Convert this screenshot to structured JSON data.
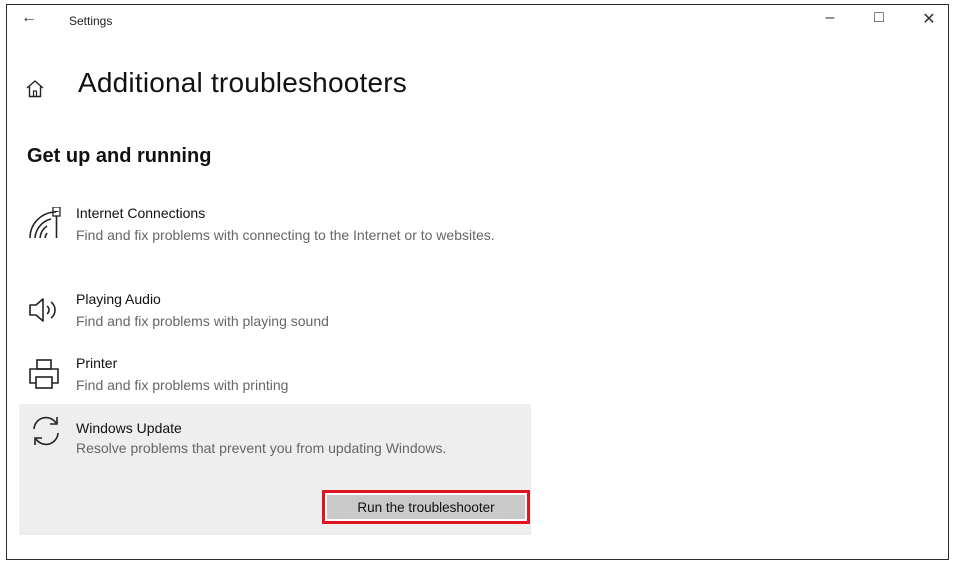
{
  "window": {
    "title": "Settings",
    "back_icon": "←",
    "minimize_icon": "–",
    "maximize_icon": "□",
    "close_icon": "✕"
  },
  "page": {
    "title": "Additional troubleshooters",
    "section_title": "Get up and running"
  },
  "items": [
    {
      "name": "Internet Connections",
      "description": "Find and fix problems with connecting to the Internet or to websites.",
      "icon": "network-icon"
    },
    {
      "name": "Playing Audio",
      "description": "Find and fix problems with playing sound",
      "icon": "speaker-icon"
    },
    {
      "name": "Printer",
      "description": "Find and fix problems with printing",
      "icon": "printer-icon"
    },
    {
      "name": "Windows Update",
      "description": "Resolve problems that prevent you from updating Windows.",
      "icon": "sync-icon",
      "selected": true
    }
  ],
  "selected_item": {
    "button_label": "Run the troubleshooter"
  },
  "colors": {
    "highlight_border": "#e0141e",
    "selected_bg": "#eeeeee",
    "button_bg": "#c9c9c9"
  }
}
